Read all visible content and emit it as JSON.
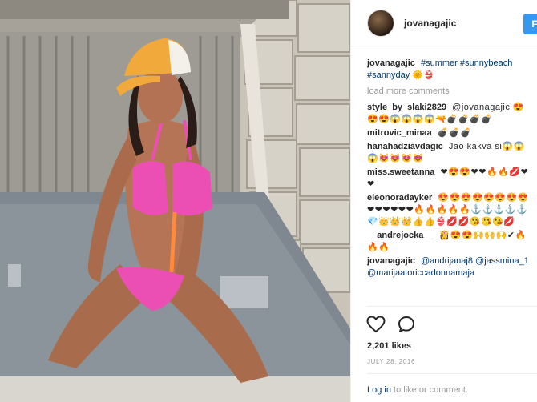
{
  "post": {
    "username": "jovanagajic",
    "follow_label": "Fo",
    "load_more": "load more comments",
    "likes": "2,201 likes",
    "date": "JULY 28, 2016",
    "login_link": "Log in",
    "login_rest": " to like or comment."
  },
  "caption": {
    "user": "jovanagajic",
    "text": "#summer #sunnybeach #sannyday 🌞👙"
  },
  "comments": [
    {
      "user": "style_by_slaki2829",
      "text": "@jovanagajic 😍😍😍😱😱😱😱🔫💣💣💣💣"
    },
    {
      "user": "mitrovic_minaa",
      "text": "💣💣💣"
    },
    {
      "user": "hanahadziavdagic",
      "text": "Jao kakva si😱😱😱😻😻😻😻"
    },
    {
      "user": "miss.sweetanna",
      "text": "❤😍😍❤❤🔥🔥💋❤❤"
    },
    {
      "user": "eleonoradayker",
      "text": "😍😍😍😍😍😍😍😍❤❤❤❤❤❤🔥🔥🔥🔥🔥⚓⚓⚓⚓⚓💎👑👑👑👍👍👙💋💋😘😘😘💋"
    },
    {
      "user": "__andrejocka__",
      "text": "👸😍😍🙌🙌🙌✔🔥🔥🔥"
    },
    {
      "user": "jovanagajic",
      "text": "@andrijanaj8 @jassmina_1 @marijaatoriccadonnamaja"
    }
  ],
  "icons": {
    "like": "heart-outline-icon",
    "comment": "speech-bubble-icon"
  },
  "colors": {
    "accent": "#3897f0",
    "link": "#003569",
    "muted": "#999999"
  }
}
